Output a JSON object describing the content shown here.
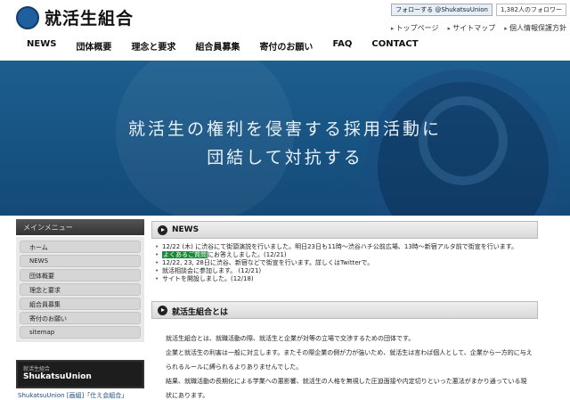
{
  "header": {
    "logo_text": "就活生組合",
    "twitter_button": "フォローする @ShukatsuUnion",
    "follower_count": "1,382人のフォロワー",
    "sub_links": [
      "トップページ",
      "サイトマップ",
      "個人情報保護方針"
    ]
  },
  "nav": [
    "NEWS",
    "団体概要",
    "理念と要求",
    "組合員募集",
    "寄付のお願い",
    "FAQ",
    "CONTACT"
  ],
  "hero": {
    "line1": "就活生の権利を侵害する採用活動に",
    "line2": "団結して対抗する"
  },
  "sidebar": {
    "title": "メインメニュー",
    "items": [
      "ホーム",
      "NEWS",
      "団体概要",
      "理念と要求",
      "組合員募集",
      "寄付のお願い",
      "sitemap"
    ],
    "banner_small": "就活生組合",
    "banner_big": "ShukatsuUnion",
    "bottom_text": "ShukatsuUnion [画組]「仕え会組合」"
  },
  "news": {
    "title": "NEWS",
    "items": [
      {
        "text": "12/22 (木) に渋谷にて街頭演説を行いました。明日23日も11時〜渋谷ハチ公前広場、13時〜新宿アルタ前で街宣を行います。"
      },
      {
        "prefix": "",
        "highlight": "よくあるご質問",
        "suffix": "にお答えしました。(12/21)"
      },
      {
        "text": "12/22, 23, 28日に渋谷、新宿などで街宣を行います。詳しくはTwitterで。"
      },
      {
        "text": "就活相談会に参加します。 (12/21)"
      },
      {
        "text": "サイトを開設しました。(12/18)"
      }
    ]
  },
  "about": {
    "title": "就活生組合とは",
    "paragraphs": [
      "就活生組合とは、就職活動の際、就活生と企業が対等の立場で交渉するための団体です。",
      "企業と就活生の利害は一般に対立します。またその際企業の側が力が強いため、就活生は言わば個人として、企業から一方的に与えられるルールに縛られるよりありませんでした。",
      "結果、就職活動の長期化による学業への悪影響、就活生の人格を無視した圧迫面接や内定切りといった悪法がまかり通っている現状にあります。"
    ]
  }
}
